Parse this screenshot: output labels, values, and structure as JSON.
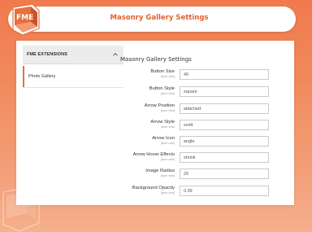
{
  "header": {
    "logo_text": "FME",
    "title": "Masonry Gallery Settings"
  },
  "sidebar": {
    "section_label": "FME EXTENSIONS",
    "section_icon": "chevron-up-icon",
    "items": [
      {
        "label": "Photo Gallery",
        "active": true
      }
    ]
  },
  "content": {
    "title": "Masonry Gallery Settings",
    "fields": [
      {
        "label": "Button Size",
        "scope": "[store view]",
        "value": "40"
      },
      {
        "label": "Button Style",
        "scope": "[store view]",
        "value": "square"
      },
      {
        "label": "Arrow Position",
        "scope": "[store view]",
        "value": "attached"
      },
      {
        "label": "Arrow Style",
        "scope": "[store view]",
        "value": "svelt"
      },
      {
        "label": "Arrow Icon",
        "scope": "[store view]",
        "value": "angle"
      },
      {
        "label": "Arrow Hover Effects",
        "scope": "[store view]",
        "value": "shrink"
      },
      {
        "label": "Image Radius",
        "scope": "[store view]",
        "value": "20"
      },
      {
        "label": "Background Opacity",
        "scope": "[store view]",
        "value": "0.99"
      }
    ]
  },
  "colors": {
    "accent": "#e86f3d",
    "background_top": "#f07a4e",
    "background_bottom": "#f5b08c",
    "title_color": "#e0622e"
  }
}
